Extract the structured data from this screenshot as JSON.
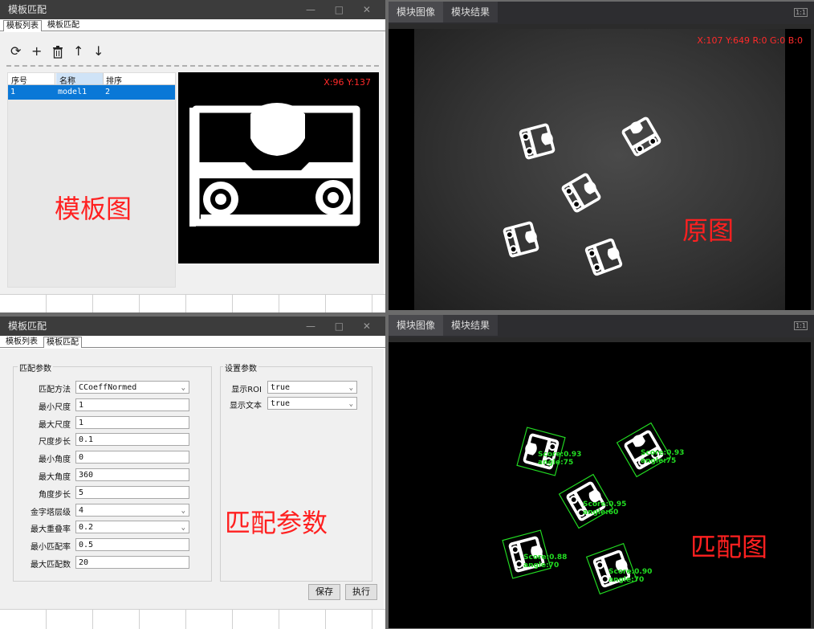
{
  "top_panel": {
    "title": "模板匹配",
    "tabs": [
      "模板列表",
      "模板匹配"
    ],
    "table": {
      "headers": [
        "序号",
        "名称",
        "排序"
      ],
      "rows": [
        [
          "1",
          "model1",
          "2"
        ]
      ]
    },
    "template_label": "模板图",
    "template_coords": "X:96 Y:137"
  },
  "bottom_panel": {
    "title": "模板匹配",
    "tabs": [
      "模板列表",
      "模板匹配"
    ],
    "match_group_title": "匹配参数",
    "settings_group_title": "设置参数",
    "match_params": [
      {
        "label": "匹配方法",
        "value": "CCoeffNormed",
        "dropdown": true
      },
      {
        "label": "最小尺度",
        "value": "1",
        "dropdown": false
      },
      {
        "label": "最大尺度",
        "value": "1",
        "dropdown": false
      },
      {
        "label": "尺度步长",
        "value": "0.1",
        "dropdown": false
      },
      {
        "label": "最小角度",
        "value": "0",
        "dropdown": false
      },
      {
        "label": "最大角度",
        "value": "360",
        "dropdown": false
      },
      {
        "label": "角度步长",
        "value": "5",
        "dropdown": false
      },
      {
        "label": "金字塔层级",
        "value": "4",
        "dropdown": true
      },
      {
        "label": "最大重叠率",
        "value": "0.2",
        "dropdown": true
      },
      {
        "label": "最小匹配率",
        "value": "0.5",
        "dropdown": false
      },
      {
        "label": "最大匹配数",
        "value": "20",
        "dropdown": false
      }
    ],
    "settings_params": [
      {
        "label": "显示ROI",
        "value": "true"
      },
      {
        "label": "显示文本",
        "value": "true"
      }
    ],
    "overlay_label": "匹配参数",
    "save_label": "保存",
    "execute_label": "执行"
  },
  "right_top": {
    "tabs": [
      "模块图像",
      "模块结果"
    ],
    "fit_label": "1:1",
    "coords": "X:107 Y:649  R:0 G:0 B:0",
    "overlay_label": "原图"
  },
  "right_bottom": {
    "tabs": [
      "模块图像",
      "模块结果"
    ],
    "fit_label": "1:1",
    "overlay_label": "匹配图",
    "matches": [
      {
        "score": "Score:0.93",
        "angle": "angle:75"
      },
      {
        "score": "Score:0.93",
        "angle": "angle:75"
      },
      {
        "score": "Score:0.95",
        "angle": "angle:60"
      },
      {
        "score": "Score:0.88",
        "angle": "angle:70"
      },
      {
        "score": "Score:0.90",
        "angle": "angle:70"
      }
    ]
  },
  "colors": {
    "accent": "#0a78d7",
    "match_green": "#22dd22",
    "overlay_red": "#ff2020"
  }
}
